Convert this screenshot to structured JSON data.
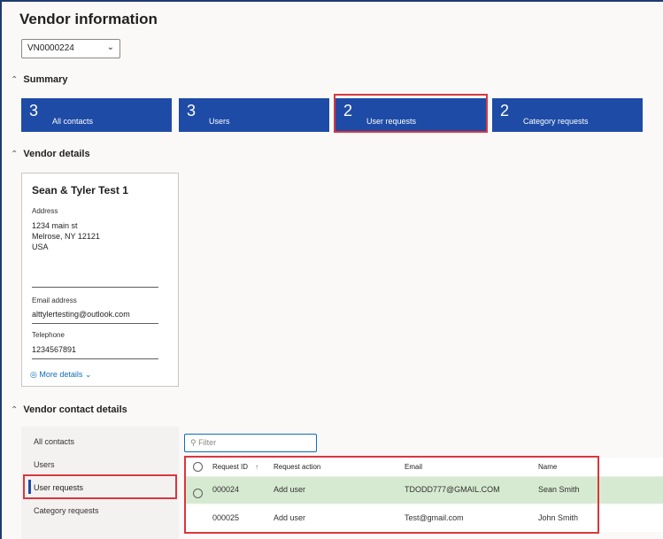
{
  "page": {
    "title": "Vendor information",
    "vendor_select_value": "VN0000224"
  },
  "summary": {
    "header": "Summary",
    "tiles": [
      {
        "count": "3",
        "label": "All contacts"
      },
      {
        "count": "3",
        "label": "Users"
      },
      {
        "count": "2",
        "label": "User requests"
      },
      {
        "count": "2",
        "label": "Category requests"
      }
    ]
  },
  "vendor_details": {
    "header": "Vendor details",
    "name": "Sean & Tyler Test 1",
    "address_label": "Address",
    "address_line1": "1234 main st",
    "address_line2": "Melrose, NY 12121",
    "address_line3": "USA",
    "email_label": "Email address",
    "email_value": "alttylertesting@outlook.com",
    "phone_label": "Telephone",
    "phone_value": "1234567891",
    "more_details": "More details"
  },
  "contact_details": {
    "header": "Vendor contact details",
    "nav": [
      "All contacts",
      "Users",
      "User requests",
      "Category requests"
    ],
    "filter_placeholder": "Filter",
    "columns": {
      "request_id": "Request ID",
      "request_action": "Request action",
      "email": "Email",
      "name": "Name"
    },
    "rows": [
      {
        "request_id": "000024",
        "request_action": "Add user",
        "email": "TDODD777@GMAIL.COM",
        "name": "Sean Smith",
        "selected": true
      },
      {
        "request_id": "000025",
        "request_action": "Add user",
        "email": "Test@gmail.com",
        "name": "John Smith",
        "selected": false
      }
    ]
  },
  "colors": {
    "tile_blue": "#1e4ba6",
    "highlight_red": "#d9373e",
    "selected_row": "#d6ead1",
    "link_blue": "#0f6cbd"
  }
}
